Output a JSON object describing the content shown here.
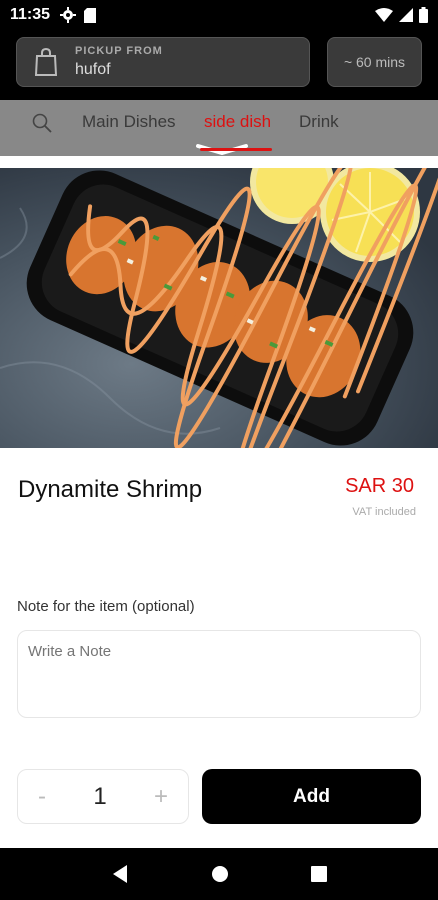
{
  "status_bar": {
    "time": "11:35"
  },
  "header": {
    "pickup_label": "PICKUP FROM",
    "pickup_value": "hufof",
    "time_estimate": "~ 60 mins"
  },
  "tabs": [
    {
      "label": "Main Dishes"
    },
    {
      "label": "side dish",
      "active": true
    },
    {
      "label": "Drink"
    }
  ],
  "product": {
    "name": "Dynamite Shrimp",
    "price": "SAR 30",
    "vat_note": "VAT included"
  },
  "note": {
    "label": "Note for the item (optional)",
    "placeholder": "Write a Note"
  },
  "quantity": {
    "minus": "-",
    "value": "1",
    "plus": "+"
  },
  "add_button": {
    "label": "Add"
  },
  "colors": {
    "accent": "#dd1111",
    "header_bg": "#000000",
    "tabs_bg": "#888888"
  }
}
